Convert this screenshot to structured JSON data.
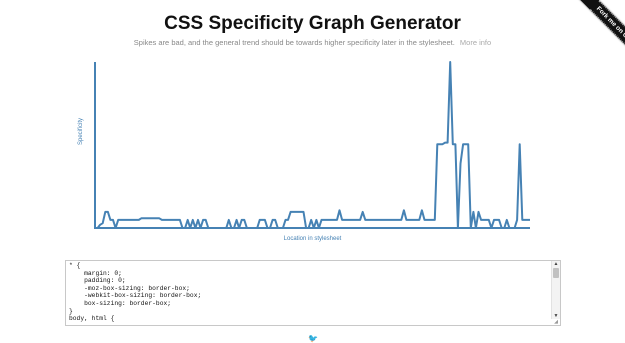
{
  "header": {
    "title": "CSS Specificity Graph Generator",
    "subtitle": "Spikes are bad, and the general trend should be towards higher specificity later in the stylesheet.",
    "more_info": "More info"
  },
  "ribbon": {
    "label": "Fork me on GitHub"
  },
  "chart_data": {
    "type": "line",
    "xlabel": "Location in stylesheet",
    "ylabel": "Specificity",
    "grid": false,
    "color": "#4682b4",
    "y_scale": "relative (no ticks printed)",
    "x": [
      0,
      1,
      2,
      3,
      4,
      5,
      6,
      7,
      8,
      9,
      10,
      11,
      12,
      13,
      14,
      15,
      16,
      17,
      18,
      19,
      20,
      21,
      22,
      23,
      24,
      25,
      26,
      27,
      28,
      29,
      30,
      31,
      32,
      33,
      34,
      35,
      36,
      37,
      38,
      39,
      40,
      41,
      42,
      43,
      44,
      45,
      46,
      47,
      48,
      49,
      50,
      51,
      52,
      53,
      54,
      55,
      56,
      57,
      58,
      59,
      60,
      61,
      62,
      63,
      64,
      65,
      66,
      67,
      68,
      69,
      70,
      71,
      72,
      73,
      74,
      75,
      76,
      77,
      78,
      79,
      80,
      81,
      82,
      83,
      84,
      85,
      86,
      87,
      88,
      89,
      90,
      91,
      92,
      93,
      94,
      95,
      96,
      97,
      98,
      99,
      100,
      101,
      102,
      103,
      104,
      105,
      106,
      107,
      108,
      109,
      110,
      111,
      112,
      113,
      114,
      115,
      116,
      117,
      118,
      119,
      120,
      121,
      122,
      123,
      124,
      125,
      126,
      127,
      128,
      129,
      130,
      131,
      132,
      133,
      134,
      135,
      136,
      137,
      138,
      139,
      140,
      141,
      142,
      143,
      144,
      145,
      146,
      147,
      148,
      149,
      150,
      151,
      152,
      153,
      154,
      155,
      156,
      157,
      158,
      159,
      160,
      161,
      162,
      163,
      164,
      165,
      166,
      167,
      168,
      169
    ],
    "y": [
      0,
      0,
      2,
      3,
      10,
      10,
      5,
      5,
      0,
      5,
      5,
      5,
      5,
      5,
      5,
      5,
      5,
      5,
      6,
      6,
      6,
      6,
      6,
      6,
      6,
      6,
      5,
      5,
      5,
      5,
      5,
      5,
      5,
      5,
      0,
      0,
      5,
      0,
      5,
      0,
      5,
      0,
      5,
      5,
      0,
      0,
      0,
      0,
      0,
      0,
      0,
      0,
      5,
      0,
      0,
      5,
      0,
      5,
      5,
      0,
      0,
      0,
      0,
      0,
      5,
      5,
      5,
      0,
      0,
      5,
      5,
      0,
      0,
      0,
      5,
      5,
      10,
      10,
      10,
      10,
      10,
      10,
      0,
      0,
      5,
      0,
      5,
      0,
      5,
      5,
      5,
      5,
      5,
      5,
      5,
      11,
      5,
      5,
      5,
      5,
      5,
      5,
      5,
      5,
      10,
      5,
      5,
      5,
      5,
      5,
      5,
      5,
      5,
      5,
      5,
      5,
      5,
      5,
      5,
      5,
      11,
      5,
      5,
      5,
      5,
      5,
      5,
      11,
      5,
      5,
      5,
      5,
      5,
      52,
      52,
      52,
      53,
      53,
      103,
      52,
      52,
      0,
      40,
      52,
      52,
      52,
      0,
      10,
      0,
      10,
      5,
      5,
      5,
      5,
      0,
      5,
      5,
      5,
      0,
      0,
      5,
      0,
      0,
      0,
      5,
      52,
      5,
      5,
      5,
      5,
      5,
      5,
      5
    ]
  },
  "editor": {
    "code": "* {\n    margin: 0;\n    padding: 0;\n    -moz-box-sizing: border-box;\n    -webkit-box-sizing: border-box;\n    box-sizing: border-box;\n}\nbody, html {"
  },
  "icons": {
    "scroll_up": "▲",
    "scroll_down": "▼",
    "resize": "◢",
    "bird": "🐦"
  }
}
